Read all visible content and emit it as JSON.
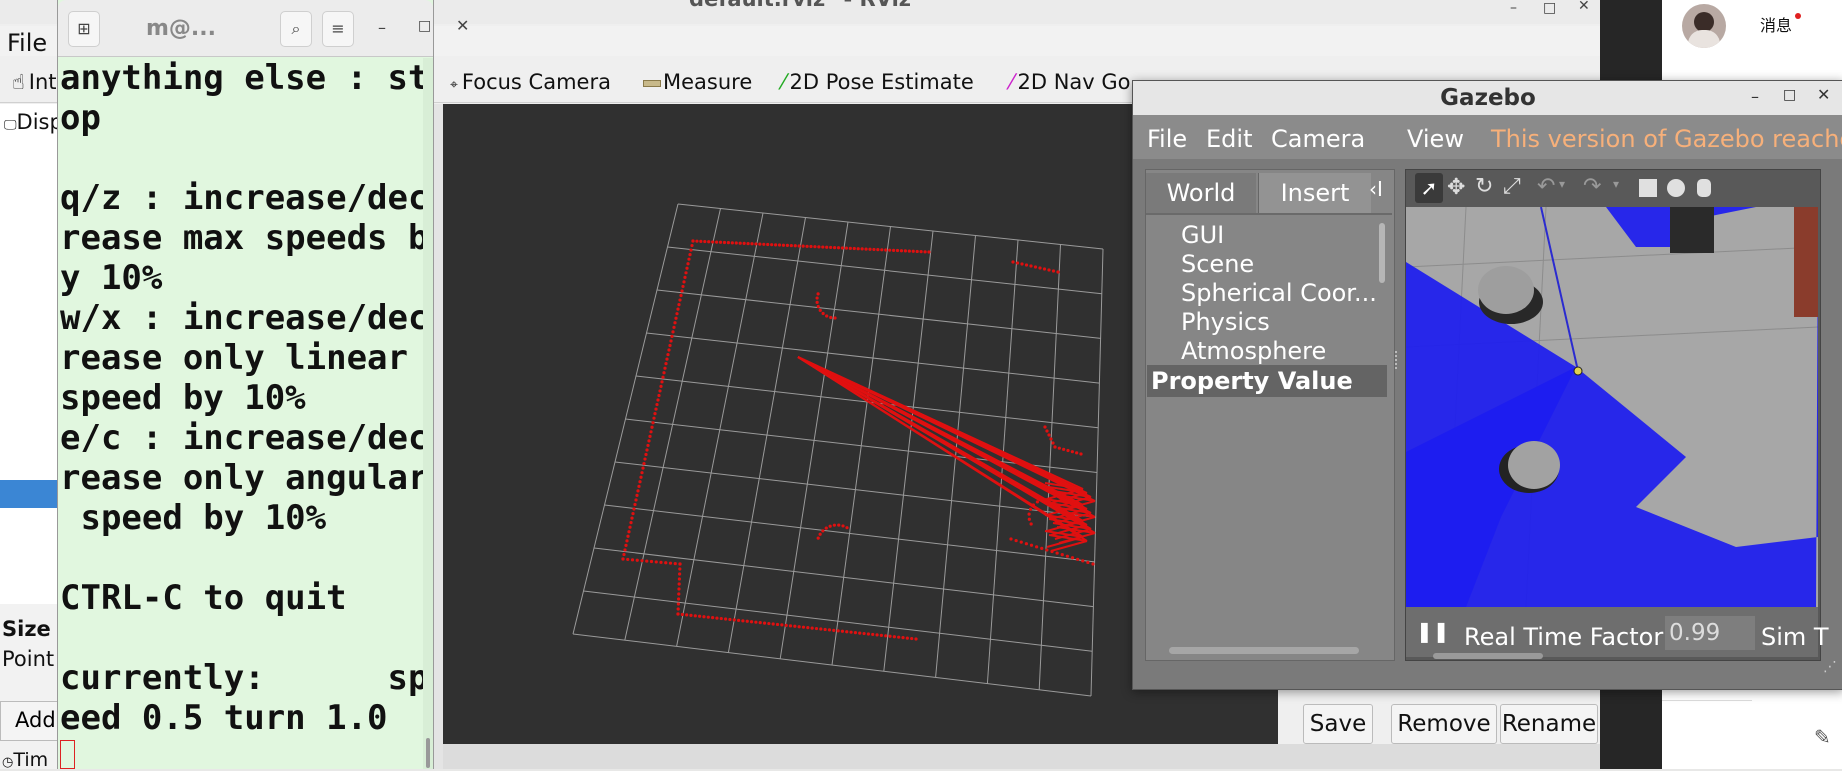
{
  "rviz": {
    "title": "default.rviz* - RViz",
    "menu_file": "File",
    "tools": {
      "interact": "Int",
      "focus_camera": "Focus Camera",
      "measure": "Measure",
      "pose_estimate": "2D Pose Estimate",
      "nav_goal": "2D Nav Go"
    },
    "panel_label_disp": "Disp",
    "size_label": "Size",
    "points_label": "Point",
    "add_label": "Add",
    "time_label": "Tim",
    "buttons": {
      "save": "Save",
      "remove": "Remove",
      "rename": "Rename"
    }
  },
  "terminal": {
    "title": "m@...",
    "lines": [
      "anything else : st",
      "op",
      "",
      "q/z : increase/dec",
      "rease max speeds b",
      "y 10%",
      "w/x : increase/dec",
      "rease only linear ",
      "speed by 10%",
      "e/c : increase/dec",
      "rease only angular",
      " speed by 10%",
      "",
      "CTRL-C to quit",
      "",
      "currently:      sp",
      "eed 0.5 turn 1.0"
    ]
  },
  "gazebo": {
    "title": "Gazebo",
    "menu": {
      "file": "File",
      "edit": "Edit",
      "camera": "Camera",
      "view": "View"
    },
    "notice": "This version of Gazebo reaches",
    "tabs": {
      "world": "World",
      "insert": "Insert"
    },
    "tree": [
      "GUI",
      "Scene",
      "Spherical Coor...",
      "Physics",
      "Atmosphere"
    ],
    "property_header": {
      "property": "Property",
      "value": "Value"
    },
    "rtf_label": "Real Time Factor:",
    "rtf_value": "0.99",
    "sim_time_label": "Sim T"
  },
  "chat": {
    "label": "消息"
  },
  "colors": {
    "laser_red": "#e01010",
    "scan_blue": "#1a1aee",
    "terminal_bg": "#e1f7df",
    "gazebo_notice": "#f7b07a"
  }
}
